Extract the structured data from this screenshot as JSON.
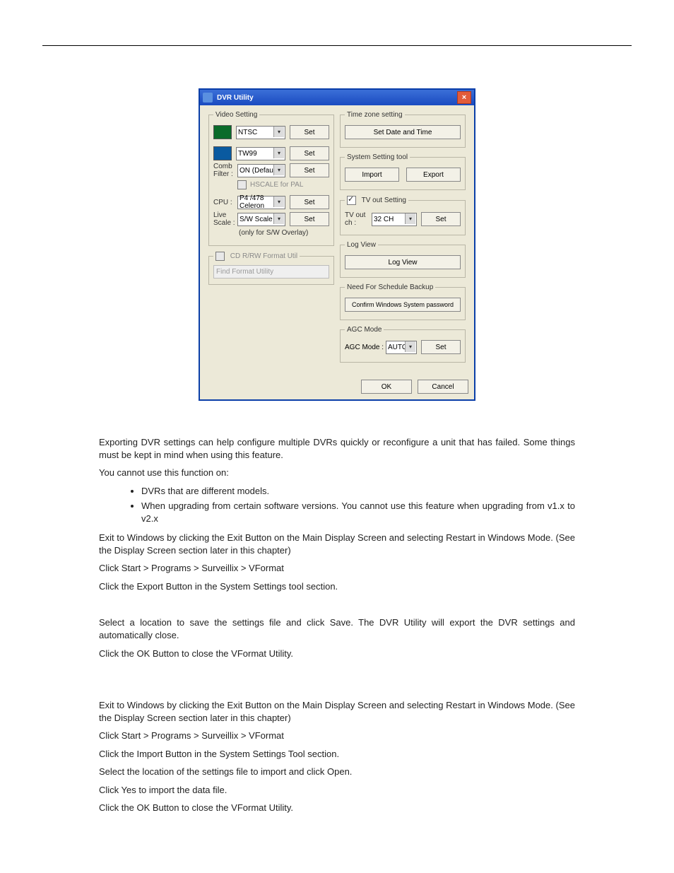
{
  "window": {
    "title": "DVR Utility",
    "video_setting": {
      "legend": "Video Setting",
      "fmt_value": "NTSC",
      "dec_value": "TW99",
      "comb_label": "Comb\nFilter :",
      "comb_value": "ON (Default)",
      "hscale_label": "HSCALE for PAL",
      "cpu_label": "CPU :",
      "cpu_value": "P4 /478 Celeron",
      "live_label": "Live\nScale :",
      "live_value": "S/W Scale",
      "live_note": "(only for S/W Overlay)",
      "set": "Set"
    },
    "cdrw": {
      "legend": "CD R/RW Format Util",
      "find": "Find Format Utility"
    },
    "tz": {
      "legend": "Time zone setting",
      "btn": "Set Date and Time"
    },
    "sys": {
      "legend": "System Setting tool",
      "import": "Import",
      "export": "Export"
    },
    "tvout": {
      "legend": "TV out Setting",
      "label": "TV out\nch :",
      "value": "32 CH",
      "set": "Set"
    },
    "log": {
      "legend": "Log View",
      "btn": "Log View"
    },
    "sched": {
      "legend": "Need For Schedule Backup",
      "btn": "Confirm Windows System password"
    },
    "agc": {
      "legend": "AGC Mode",
      "label": "AGC Mode :",
      "value": "AUTO",
      "set": "Set"
    },
    "ok": "OK",
    "cancel": "Cancel"
  },
  "doc": {
    "p1": "Exporting DVR settings can help configure multiple DVRs quickly or reconfigure a unit that has failed. Some things must be kept in mind when using this feature.",
    "p2": "You cannot use this function on:",
    "li1": "DVRs that are different models.",
    "li2": "When upgrading from certain software versions. You cannot use this feature when upgrading from v1.x to v2.x",
    "e1": "Exit to Windows by clicking the Exit Button on the Main Display Screen and selecting Restart in Windows Mode. (See the Display Screen section later in this chapter)",
    "e2": "Click Start > Programs > Surveillix > VFormat",
    "e3": "Click the Export Button in the System Settings tool section.",
    "e4": "Select a location to save the settings file and click Save. The DVR Utility will export the DVR settings and automatically close.",
    "e5": "Click the OK Button to close the VFormat Utility.",
    "i1": "Exit to Windows by clicking the Exit Button on the Main Display Screen and selecting Restart in Windows Mode. (See the Display Screen section later in this chapter)",
    "i2": "Click Start > Programs > Surveillix > VFormat",
    "i3": "Click the Import Button in the System Settings Tool section.",
    "i4": "Select the location of the settings file to import and click Open.",
    "i5": "Click Yes to import the data file.",
    "i6": "Click the OK Button to close the VFormat Utility."
  }
}
